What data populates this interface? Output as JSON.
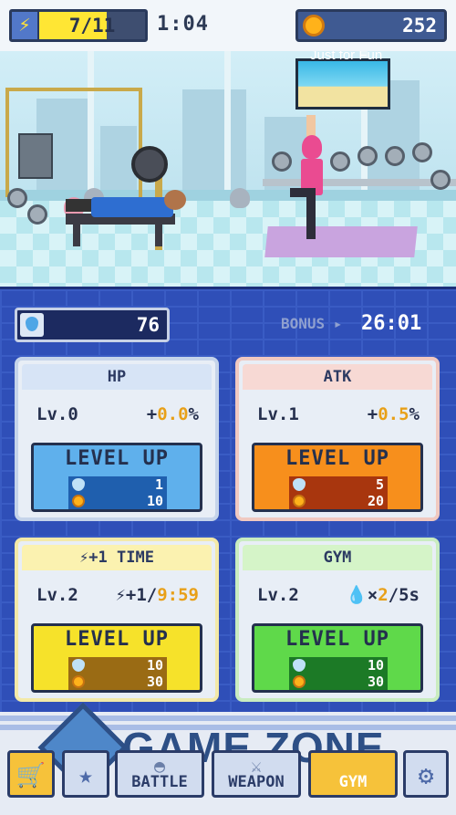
{
  "hud": {
    "energy_icon": "lightning-icon",
    "energy_text": "7/11",
    "energy_fraction": 0.636,
    "timer": "1:04",
    "coin_icon": "coin-icon",
    "coins": "252"
  },
  "sweat": {
    "icon": "drop-icon",
    "value": "76"
  },
  "bonus": {
    "label": "BONUS ▸",
    "time": "26:01"
  },
  "cards": {
    "hp": {
      "title": "HP",
      "level": "Lv.0",
      "effect_prefix": "+",
      "effect_value": "0.0",
      "effect_suffix": "%",
      "button": "LEVEL UP",
      "cost_drops": "1",
      "cost_coins": "10",
      "colors": {
        "head": "#d7e4f6",
        "head_text": "#2c3a62",
        "button": "#5fb0ec",
        "button_dark": "#1f5fae"
      }
    },
    "atk": {
      "title": "ATK",
      "level": "Lv.1",
      "effect_prefix": "+",
      "effect_value": "0.5",
      "effect_suffix": "%",
      "button": "LEVEL UP",
      "cost_drops": "5",
      "cost_coins": "20",
      "colors": {
        "head": "#f7d9d4",
        "head_text": "#2c3a62",
        "button": "#f78f1c",
        "button_dark": "#a8360e"
      }
    },
    "time": {
      "title": "⚡+1 TIME",
      "level": "Lv.2",
      "effect_prefix": "⚡+1/",
      "effect_value": "9:59",
      "effect_suffix": "",
      "button": "LEVEL UP",
      "cost_drops": "10",
      "cost_coins": "30",
      "colors": {
        "head": "#fbf2b0",
        "head_text": "#2c3a62",
        "button": "#f6e22a",
        "button_dark": "#9a6b14"
      }
    },
    "gym": {
      "title": "GYM",
      "level": "Lv.2",
      "effect_prefix": "💧×",
      "effect_value": "2",
      "effect_suffix": "/5s",
      "button": "LEVEL UP",
      "cost_drops": "10",
      "cost_coins": "30",
      "colors": {
        "head": "#d5f4c8",
        "head_text": "#2c3a62",
        "button": "#5fd94a",
        "button_dark": "#1c7a26"
      }
    }
  },
  "watermark": {
    "name": "GAME ZONE",
    "tagline": "Just for Fun"
  },
  "nav": {
    "shop_icon": "cart-icon",
    "ranking_icon": "star-icon",
    "battle": "BATTLE",
    "weapon": "WEAPON",
    "gym": "GYM",
    "settings_icon": "gear-icon"
  }
}
